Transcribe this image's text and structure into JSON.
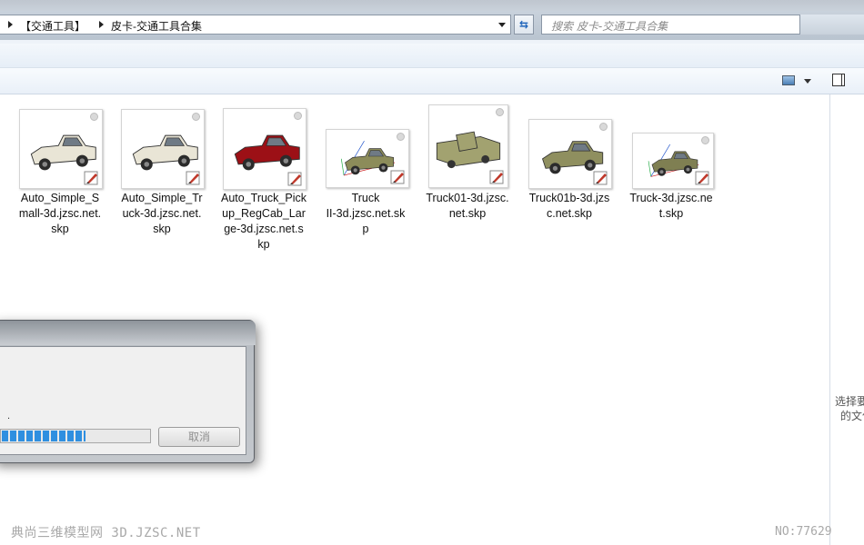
{
  "address_bar": {
    "breadcrumbs": [
      "【交通工具】",
      "皮卡-交通工具合集"
    ],
    "search_placeholder": "搜索 皮卡-交通工具合集"
  },
  "files": [
    {
      "name": "Auto_Simple_Small-3d.jzsc.net.skp",
      "label_lines": [
        "Auto_Simple_S",
        "mall-3d.jzsc.net.",
        "skp"
      ],
      "thumb_icon": "white-pickup-truck",
      "body_color": "#e9e5d6"
    },
    {
      "name": "Auto_Simple_Truck-3d.jzsc.net.skp",
      "label_lines": [
        "Auto_Simple_Tr",
        "uck-3d.jzsc.net.",
        "skp"
      ],
      "thumb_icon": "white-pickup-truck",
      "body_color": "#e9e5d6"
    },
    {
      "name": "Auto_Truck_Pickup_RegCab_Large-3d.jzsc.net.skp",
      "label_lines": [
        "Auto_Truck_Pick",
        "up_RegCab_Lar",
        "ge-3d.jzsc.net.s",
        "kp"
      ],
      "thumb_icon": "red-pickup-truck",
      "body_color": "#9c1016"
    },
    {
      "name": "Truck II-3d.jzsc.net.skp",
      "label_lines": [
        "Truck",
        "II-3d.jzsc.net.sk",
        "p"
      ],
      "thumb_icon": "olive-pickup-truck-with-axes",
      "body_color": "#8c8c5a"
    },
    {
      "name": "Truck01-3d.jzsc.net.skp",
      "label_lines": [
        "Truck01-3d.jzsc.",
        "net.skp"
      ],
      "thumb_icon": "olive-boxy-pickup-truck",
      "body_color": "#a2a270"
    },
    {
      "name": "Truck01b-3d.jzsc.net.skp",
      "label_lines": [
        "Truck01b-3d.jzs",
        "c.net.skp"
      ],
      "thumb_icon": "olive-pickup-truck",
      "body_color": "#8f8f5f"
    },
    {
      "name": "Truck-3d.jzsc.net.skp",
      "label_lines": [
        "Truck-3d.jzsc.ne",
        "t.skp"
      ],
      "thumb_icon": "olive-pickup-truck-with-axes",
      "body_color": "#7f7f52"
    }
  ],
  "details_pane": {
    "text_lines": [
      "选择要",
      "的文件"
    ]
  },
  "progress_dialog": {
    "cancel_label": "取消",
    "progress_fraction": 0.56,
    "status_text": "."
  },
  "watermark": {
    "left": "典尚三维模型网 3D.JZSC.NET",
    "right": "NO:77629"
  },
  "colors": {
    "progress": "#2f8fe0",
    "toolbar": "#e6eef7",
    "sketchup_badge": "#c0392b"
  }
}
